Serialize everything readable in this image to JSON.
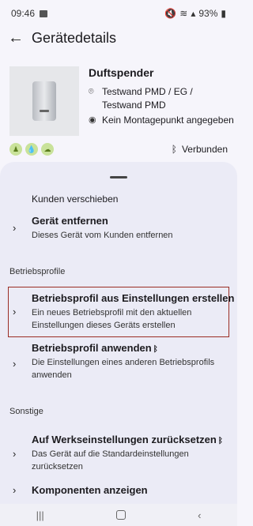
{
  "status": {
    "time": "09:46",
    "battery": "93%"
  },
  "appbar": {
    "title": "Gerätedetails"
  },
  "device": {
    "name": "Duftspender",
    "location": "Testwand PMD / EG / Testwand PMD",
    "mountpoint": "Kein Montagepunkt angegeben",
    "connection": "Verbunden"
  },
  "sheet": {
    "items": [
      {
        "title": "Kunden verschieben"
      },
      {
        "title": "Gerät entfernen",
        "subtitle": "Dieses Gerät vom Kunden entfernen"
      },
      {
        "section": "Betriebsprofile"
      },
      {
        "title": "Betriebsprofil aus Einstellungen erstellen",
        "subtitle": "Ein neues Betriebsprofil mit den aktuellen Einstellungen dieses Geräts erstellen"
      },
      {
        "title": "Betriebsprofil anwenden",
        "subtitle": "Die Einstellungen eines anderen Betriebsprofils anwenden"
      },
      {
        "section": "Sonstige"
      },
      {
        "title": "Auf Werkseinstellungen zurücksetzen",
        "subtitle": "Das Gerät auf die Standardeinstellungen zurücksetzen"
      },
      {
        "title": "Komponenten anzeigen"
      }
    ]
  },
  "icons": {
    "back": "arrow-left-icon",
    "location": "location-pin-icon",
    "mountpoint": "target-icon",
    "bluetooth": "bluetooth-icon",
    "chevron": "chevron-right-icon"
  }
}
